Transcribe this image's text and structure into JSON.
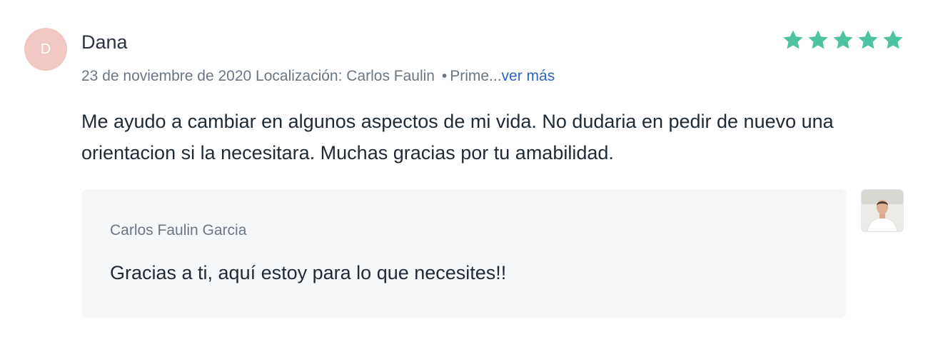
{
  "review": {
    "avatar_initial": "D",
    "author": "Dana",
    "rating": 5,
    "rating_max": 5,
    "star_color": "#4ec3a2",
    "date": "23 de noviembre de 2020",
    "location": "Localización: Carlos Faulin",
    "separator": "•",
    "truncated_info": "Prime...",
    "more_link": "ver más",
    "text": "Me ayudo a cambiar en algunos aspectos de mi vida. No dudaria en pedir de nuevo una orientacion si la necesitara. Muchas gracias por tu amabilidad."
  },
  "reply": {
    "author": "Carlos Faulin Garcia",
    "text": "Gracias a ti, aquí estoy para lo que necesites!!",
    "avatar_icon": "profile-photo"
  }
}
